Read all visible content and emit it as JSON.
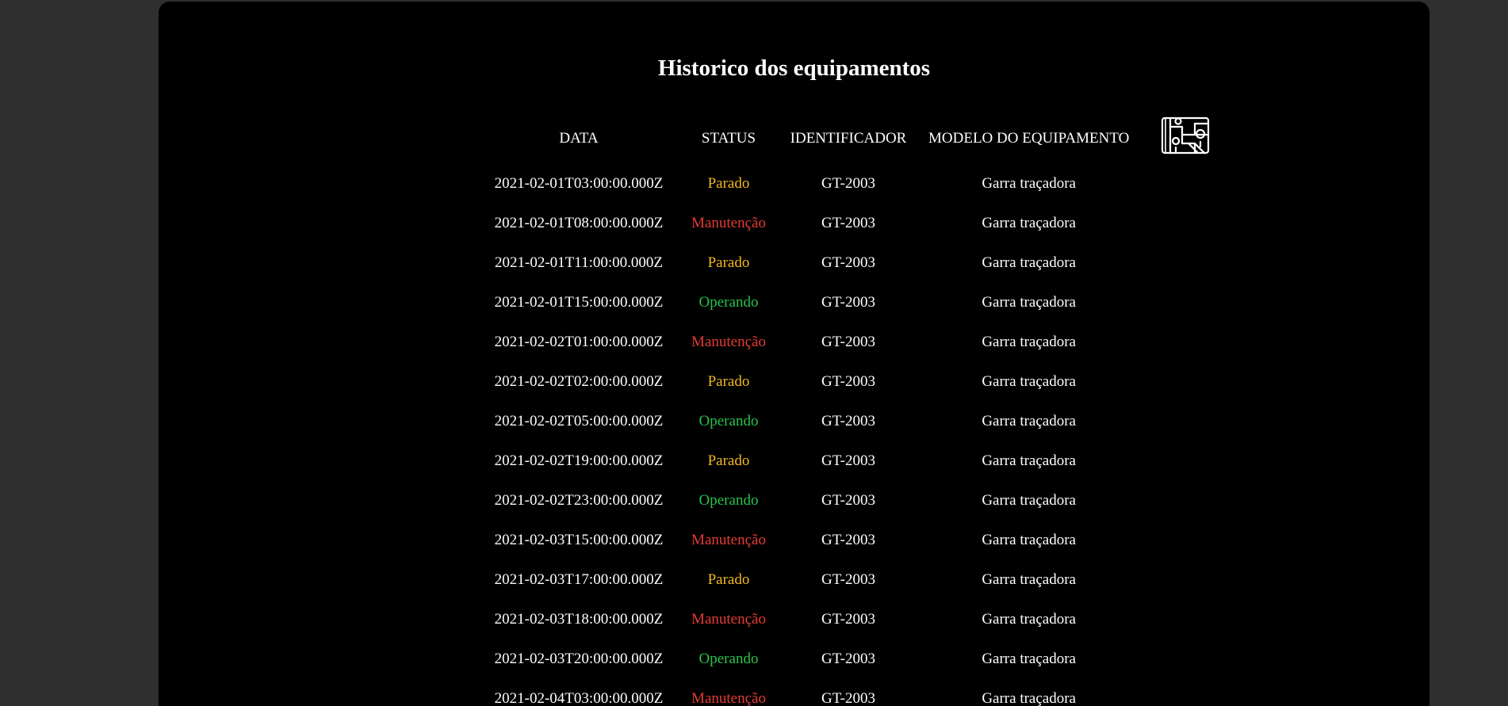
{
  "page": {
    "title": "Historico dos equipamentos"
  },
  "colors": {
    "page_background": "#2f2f2f",
    "panel_background": "#000000",
    "text": "#ffffff",
    "status_parado": "#f2b91d",
    "status_manutencao": "#e53b33",
    "status_operando": "#27c24c"
  },
  "table": {
    "headers": {
      "data": "DATA",
      "status": "STATUS",
      "identificador": "IDENTIFICADOR",
      "modelo": "MODELO DO EQUIPAMENTO"
    },
    "map_icon": "map-icon",
    "rows": [
      {
        "data": "2021-02-01T03:00:00.000Z",
        "status": "Parado",
        "status_key": "parado",
        "identificador": "GT-2003",
        "modelo": "Garra traçadora"
      },
      {
        "data": "2021-02-01T08:00:00.000Z",
        "status": "Manutenção",
        "status_key": "manutencao",
        "identificador": "GT-2003",
        "modelo": "Garra traçadora"
      },
      {
        "data": "2021-02-01T11:00:00.000Z",
        "status": "Parado",
        "status_key": "parado",
        "identificador": "GT-2003",
        "modelo": "Garra traçadora"
      },
      {
        "data": "2021-02-01T15:00:00.000Z",
        "status": "Operando",
        "status_key": "operando",
        "identificador": "GT-2003",
        "modelo": "Garra traçadora"
      },
      {
        "data": "2021-02-02T01:00:00.000Z",
        "status": "Manutenção",
        "status_key": "manutencao",
        "identificador": "GT-2003",
        "modelo": "Garra traçadora"
      },
      {
        "data": "2021-02-02T02:00:00.000Z",
        "status": "Parado",
        "status_key": "parado",
        "identificador": "GT-2003",
        "modelo": "Garra traçadora"
      },
      {
        "data": "2021-02-02T05:00:00.000Z",
        "status": "Operando",
        "status_key": "operando",
        "identificador": "GT-2003",
        "modelo": "Garra traçadora"
      },
      {
        "data": "2021-02-02T19:00:00.000Z",
        "status": "Parado",
        "status_key": "parado",
        "identificador": "GT-2003",
        "modelo": "Garra traçadora"
      },
      {
        "data": "2021-02-02T23:00:00.000Z",
        "status": "Operando",
        "status_key": "operando",
        "identificador": "GT-2003",
        "modelo": "Garra traçadora"
      },
      {
        "data": "2021-02-03T15:00:00.000Z",
        "status": "Manutenção",
        "status_key": "manutencao",
        "identificador": "GT-2003",
        "modelo": "Garra traçadora"
      },
      {
        "data": "2021-02-03T17:00:00.000Z",
        "status": "Parado",
        "status_key": "parado",
        "identificador": "GT-2003",
        "modelo": "Garra traçadora"
      },
      {
        "data": "2021-02-03T18:00:00.000Z",
        "status": "Manutenção",
        "status_key": "manutencao",
        "identificador": "GT-2003",
        "modelo": "Garra traçadora"
      },
      {
        "data": "2021-02-03T20:00:00.000Z",
        "status": "Operando",
        "status_key": "operando",
        "identificador": "GT-2003",
        "modelo": "Garra traçadora"
      },
      {
        "data": "2021-02-04T03:00:00.000Z",
        "status": "Manutenção",
        "status_key": "manutencao",
        "identificador": "GT-2003",
        "modelo": "Garra traçadora"
      }
    ]
  }
}
